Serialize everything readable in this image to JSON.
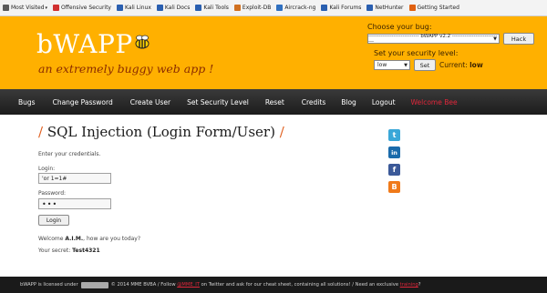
{
  "bookmarks": [
    {
      "label": "Most Visited",
      "icon": "gear-icon",
      "color": "#5a5a5a",
      "dropdown": true
    },
    {
      "label": "Offensive Security",
      "icon": "offsec-icon",
      "color": "#d03030"
    },
    {
      "label": "Kali Linux",
      "icon": "kali-icon",
      "color": "#2a5fb0"
    },
    {
      "label": "Kali Docs",
      "icon": "kali-icon",
      "color": "#2a5fb0"
    },
    {
      "label": "Kali Tools",
      "icon": "kali-icon",
      "color": "#2a5fb0"
    },
    {
      "label": "Exploit-DB",
      "icon": "exploitdb-icon",
      "color": "#d07020"
    },
    {
      "label": "Aircrack-ng",
      "icon": "aircrack-icon",
      "color": "#3070c0"
    },
    {
      "label": "Kali Forums",
      "icon": "kali-icon",
      "color": "#2a5fb0"
    },
    {
      "label": "NetHunter",
      "icon": "kali-icon",
      "color": "#2a5fb0"
    },
    {
      "label": "Getting Started",
      "icon": "firefox-icon",
      "color": "#e06010"
    }
  ],
  "header": {
    "logo": "bWAPP",
    "tagline": "an extremely buggy web app !",
    "choose_label": "Choose your bug:",
    "bug_selected": "---------------------------- bWAPP v2.2 ----------------------------",
    "hack_label": "Hack",
    "security_label": "Set your security level:",
    "level_selected": "low",
    "set_label": "Set",
    "current_prefix": "Current:",
    "current_level": "low"
  },
  "nav": [
    "Bugs",
    "Change Password",
    "Create User",
    "Set Security Level",
    "Reset",
    "Credits",
    "Blog",
    "Logout",
    "Welcome Bee"
  ],
  "main": {
    "title_slash_left": "/",
    "title": "SQL Injection (Login Form/User)",
    "title_slash_right": "/",
    "instructions": "Enter your credentials.",
    "login_label": "Login:",
    "login_value": "'or 1=1#",
    "password_label": "Password:",
    "password_value": "•••",
    "login_button": "Login",
    "welcome_prefix": "Welcome ",
    "welcome_name": "A.I.M.",
    "welcome_suffix": ", how are you today?",
    "secret_prefix": "Your secret: ",
    "secret_value": "Test4321"
  },
  "social": [
    {
      "name": "twitter",
      "glyph": "t",
      "color": "#3aa7d8"
    },
    {
      "name": "linkedin",
      "glyph": "in",
      "color": "#1a6bab"
    },
    {
      "name": "facebook",
      "glyph": "f",
      "color": "#3b5998"
    },
    {
      "name": "blogger",
      "glyph": "B",
      "color": "#f07a1a"
    }
  ],
  "footer": {
    "part1": "bWAPP is licensed under",
    "part2": "© 2014 MME BVBA / Follow",
    "twitter_handle": "@MME_IT",
    "part3": "on Twitter and ask for our cheat sheet, containing all solutions! / Need an exclusive",
    "training_link": "training",
    "part4": "?"
  }
}
